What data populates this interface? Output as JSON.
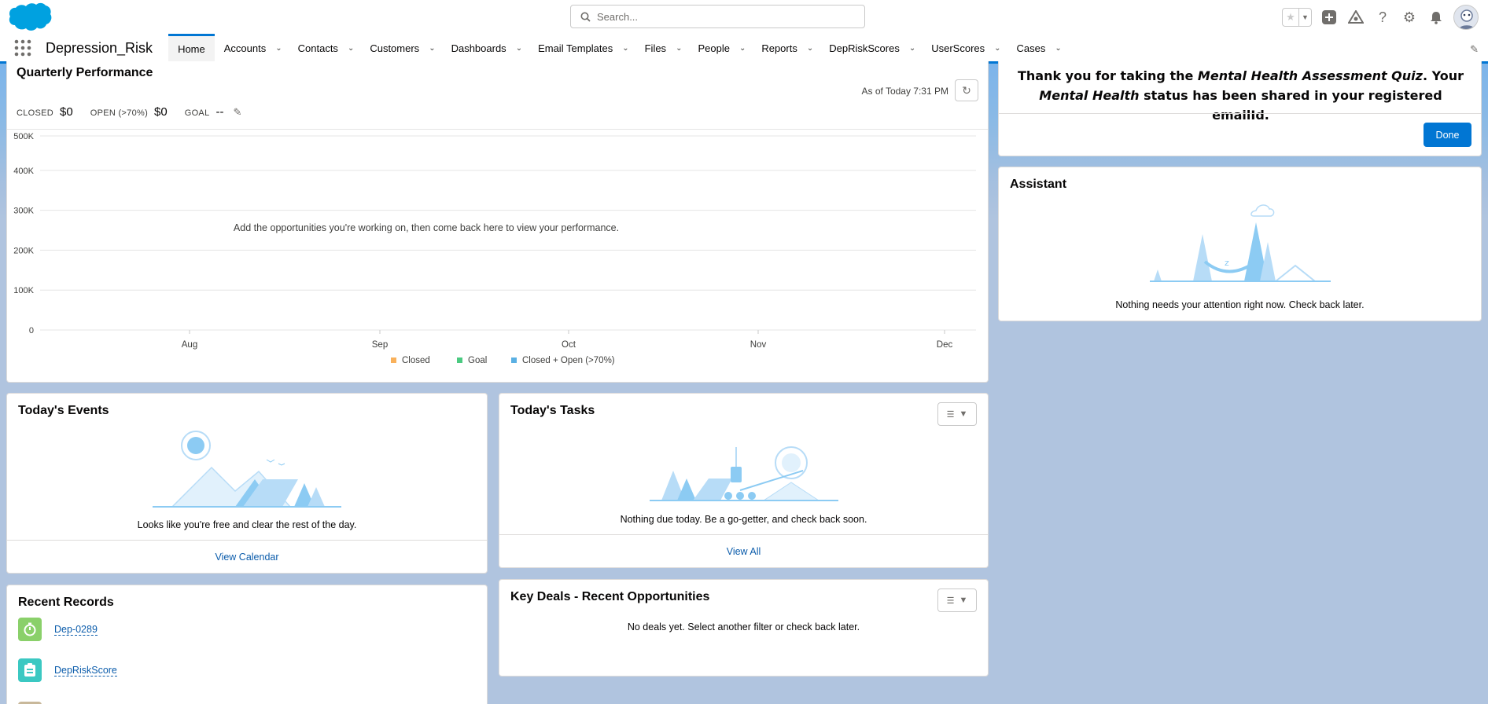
{
  "header": {
    "search_placeholder": "Search...",
    "icons": [
      "star-icon",
      "add-icon",
      "trailhead-icon",
      "help-icon",
      "setup-gear-icon",
      "notifications-bell-icon",
      "avatar"
    ]
  },
  "nav": {
    "app_name": "Depression_Risk",
    "items": [
      {
        "label": "Home",
        "active": true
      },
      {
        "label": "Accounts"
      },
      {
        "label": "Contacts"
      },
      {
        "label": "Customers"
      },
      {
        "label": "Dashboards"
      },
      {
        "label": "Email Templates"
      },
      {
        "label": "Files"
      },
      {
        "label": "People"
      },
      {
        "label": "Reports"
      },
      {
        "label": "DepRiskScores"
      },
      {
        "label": "UserScores"
      },
      {
        "label": "Cases"
      }
    ]
  },
  "performance": {
    "title": "Quarterly Performance",
    "as_of": "As of Today 7:31 PM",
    "closed_label": "CLOSED",
    "closed_value": "$0",
    "open_label": "OPEN (>70%)",
    "open_value": "$0",
    "goal_label": "GOAL",
    "goal_value": "--",
    "empty_message": "Add the opportunities you're working on, then come back here to view your performance."
  },
  "chart_data": {
    "type": "line",
    "x": [
      "Aug",
      "Sep",
      "Oct",
      "Nov",
      "Dec"
    ],
    "y_ticks": [
      "0",
      "100K",
      "200K",
      "300K",
      "400K",
      "500K"
    ],
    "ylim": [
      0,
      500000
    ],
    "series": [
      {
        "name": "Closed",
        "values": [],
        "color": "#f9b15b"
      },
      {
        "name": "Goal",
        "values": [],
        "color": "#4bca81"
      },
      {
        "name": "Closed + Open (>70%)",
        "values": [],
        "color": "#5ab0e3"
      }
    ],
    "legend": "bottom",
    "grid": true
  },
  "events": {
    "title": "Today's Events",
    "empty": "Looks like you're free and clear the rest of the day.",
    "footer_link": "View Calendar"
  },
  "tasks": {
    "title": "Today's Tasks",
    "empty": "Nothing due today. Be a go-getter, and check back soon.",
    "footer_link": "View All"
  },
  "records": {
    "title": "Recent Records",
    "items": [
      {
        "label": "Dep-0289",
        "color": "#8ad06a"
      },
      {
        "label": "DepRiskScore",
        "color": "#3bc8c2"
      }
    ]
  },
  "deals": {
    "title": "Key Deals - Recent Opportunities",
    "empty": "No deals yet. Select another filter or check back later."
  },
  "thank_you": {
    "part1": "Thank you for taking the ",
    "quiz": "Mental Health Assessment Quiz",
    "part2": ". Your ",
    "status": "Mental Health",
    "part3": " status has been shared in your registered emailId.",
    "done_label": "Done"
  },
  "assistant": {
    "title": "Assistant",
    "empty": "Nothing needs your attention right now. Check back later."
  }
}
